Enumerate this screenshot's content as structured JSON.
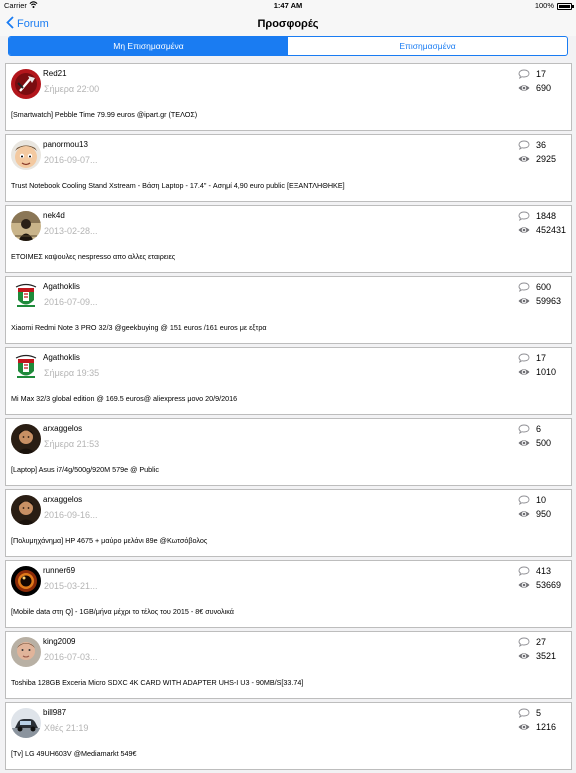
{
  "status_bar": {
    "carrier": "Carrier",
    "time": "1:47 AM",
    "battery": "100%"
  },
  "nav": {
    "back_label": "Forum",
    "title": "Προσφορές"
  },
  "tabs": [
    {
      "label": "Μη Επισημασμένα",
      "active": true
    },
    {
      "label": "Επισημασμένα",
      "active": false
    }
  ],
  "colors": {
    "accent": "#1a7cf2"
  },
  "posts": [
    {
      "user": "Red21",
      "date": "Σήμερα 22:00",
      "title": "[Smartwatch] Pebble Time 79.99 euros @ipart.gr (ΤΕΛΟΣ)",
      "replies": "17",
      "views": "690",
      "avatar": "red-axe"
    },
    {
      "user": "panormou13",
      "date": "2016-09-07...",
      "title": "Trust Notebook Cooling Stand Xstream - Βάση Laptop - 17.4\" - Ασημί 4,90 euro public [ΕΞΑΝΤΛΗΘΗΚΕ]",
      "replies": "36",
      "views": "2925",
      "avatar": "cartoon-face"
    },
    {
      "user": "nek4d",
      "date": "2013-02-28...",
      "title": "ΕΤΟΙΜΕΣ καψουλες nespresso απο αλλες εταιρειες",
      "replies": "1848",
      "views": "452431",
      "avatar": "dark-figure"
    },
    {
      "user": "Agathoklis",
      "date": "2016-07-09...",
      "title": "Xiaomi Redmi Note 3 PRO 32/3 @geekbuying @ 151 euros  /161 euros με εξτρα",
      "replies": "600",
      "views": "59963",
      "avatar": "green-crest"
    },
    {
      "user": "Agathoklis",
      "date": "Σήμερα 19:35",
      "title": "Mi Max 32/3 global edition @ 169.5 euros@ aliexpress μονο 20/9/2016",
      "replies": "17",
      "views": "1010",
      "avatar": "green-crest"
    },
    {
      "user": "arxaggelos",
      "date": "Σήμερα 21:53",
      "title": "[Laptop] Asus i7/4g/500g/920M 579e @ Public",
      "replies": "6",
      "views": "500",
      "avatar": "portrait"
    },
    {
      "user": "arxaggelos",
      "date": "2016-09-16...",
      "title": "[Πολυμηχάνημα] HP 4675 + μαύρο μελάνι 89e @Κωτσόβολος",
      "replies": "10",
      "views": "950",
      "avatar": "portrait"
    },
    {
      "user": "runner69",
      "date": "2015-03-21...",
      "title": "[Mobile data στη Q] - 1GB/μήνα μέχρι το τέλος του 2015 - 8€ συνολικά",
      "replies": "413",
      "views": "53669",
      "avatar": "dark-sun"
    },
    {
      "user": "king2009",
      "date": "2016-07-03...",
      "title": "Toshiba 128GB Exceria Micro SDXC 4K CARD WITH ADAPTER UHS-I U3 - 90MB/S[33.74]",
      "replies": "27",
      "views": "3521",
      "avatar": "face-photo"
    },
    {
      "user": "bill987",
      "date": "Χθές 21:19",
      "title": "[Tv] LG 49UH603V @Mediamarkt 549€",
      "replies": "5",
      "views": "1216",
      "avatar": "car"
    }
  ]
}
